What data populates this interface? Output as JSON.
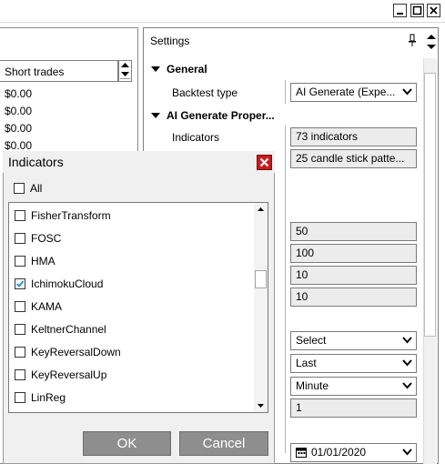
{
  "left_panel": {
    "column_header": "Short trades",
    "values": [
      "$0.00",
      "$0.00",
      "$0.00",
      "$0.00"
    ]
  },
  "settings": {
    "title": "Settings",
    "categories": [
      {
        "label": "General"
      },
      {
        "label": "AI Generate Proper..."
      }
    ],
    "properties": {
      "backtest_type_label": "Backtest type",
      "backtest_type_value": "AI Generate (Expe...",
      "indicators_label": "Indicators",
      "indicators_value": "73 indicators",
      "candles_value": "25 candle stick patte..."
    },
    "values": [
      "50",
      "100",
      "10",
      "10"
    ],
    "dropdowns": [
      "Select",
      "Last",
      "Minute"
    ],
    "value_after_dropdowns": "1",
    "date_value": "01/01/2020"
  },
  "dialog": {
    "title": "Indicators",
    "all_label": "All",
    "items": [
      {
        "label": "FisherTransform",
        "checked": false
      },
      {
        "label": "FOSC",
        "checked": false
      },
      {
        "label": "HMA",
        "checked": false
      },
      {
        "label": "IchimokuCloud",
        "checked": true
      },
      {
        "label": "KAMA",
        "checked": false
      },
      {
        "label": "KeltnerChannel",
        "checked": false
      },
      {
        "label": "KeyReversalDown",
        "checked": false
      },
      {
        "label": "KeyReversalUp",
        "checked": false
      },
      {
        "label": "LinReg",
        "checked": false
      }
    ],
    "ok_label": "OK",
    "cancel_label": "Cancel"
  },
  "colors": {
    "close_button": "#c61d1d",
    "dialog_button": "#8e8e8e",
    "check_mark": "#1e90c8"
  }
}
